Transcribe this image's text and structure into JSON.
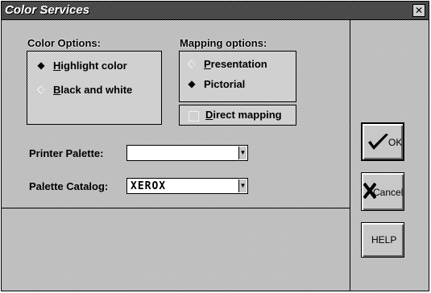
{
  "window": {
    "title": "Color Services"
  },
  "color_options": {
    "label": "Color Options:",
    "items": [
      {
        "label": "Highlight color",
        "selected": true
      },
      {
        "label": "Black and white",
        "selected": false
      }
    ]
  },
  "mapping_options": {
    "label": "Mapping options:",
    "items": [
      {
        "label": "Presentation",
        "selected": false
      },
      {
        "label": "Pictorial",
        "selected": true
      }
    ],
    "direct_mapping_label": "Direct mapping",
    "direct_mapping_checked": false
  },
  "printer_palette": {
    "label": "Printer Palette:",
    "value": ""
  },
  "palette_catalog": {
    "label": "Palette Catalog:",
    "value": "XEROX"
  },
  "buttons": {
    "ok": "OK",
    "cancel": "Cancel",
    "help": "HELP"
  },
  "icons": {
    "close": "close-icon",
    "ok": "checkmark-icon",
    "cancel": "x-icon",
    "dropdown": "dropdown-arrow-icon"
  }
}
